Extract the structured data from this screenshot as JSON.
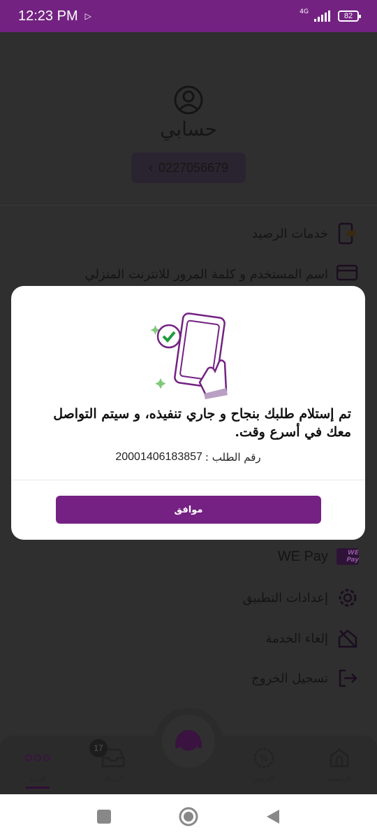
{
  "status_bar": {
    "time": "12:23 PM",
    "network": "4G",
    "battery": "82"
  },
  "profile": {
    "title": "حسابي",
    "phone": "0227056679"
  },
  "menu": [
    {
      "label": "خدمات الرصيد",
      "icon": "balance-services-icon"
    },
    {
      "label": "اسم المستخدم و كلمة المرور للانترنت المنزلي",
      "icon": "credentials-card-icon"
    },
    {
      "label": "WE Pay",
      "icon": "we-pay-logo",
      "logo_text": "WE Pay"
    },
    {
      "label": "إعدادات التطبيق",
      "icon": "gear-icon"
    },
    {
      "label": "إلغاء الخدمة",
      "icon": "cancel-service-icon"
    },
    {
      "label": "تسجيل الخروج",
      "icon": "logout-icon"
    }
  ],
  "modal": {
    "message": "تم إستلام طلبك بنجاح و جاري تنفيذه، و سيتم التواصل معك في أسرع وقت.",
    "order_label": "رقم الطلب :",
    "order_number": "20001406183857",
    "ok_label": "موافق"
  },
  "bottom_nav": {
    "more": "المزيد",
    "messages": "الرسائل",
    "offers": "العروض",
    "home": "الرئيسية",
    "messages_badge": "17"
  },
  "colors": {
    "brand": "#732282",
    "accent_green": "#7ec97a"
  }
}
